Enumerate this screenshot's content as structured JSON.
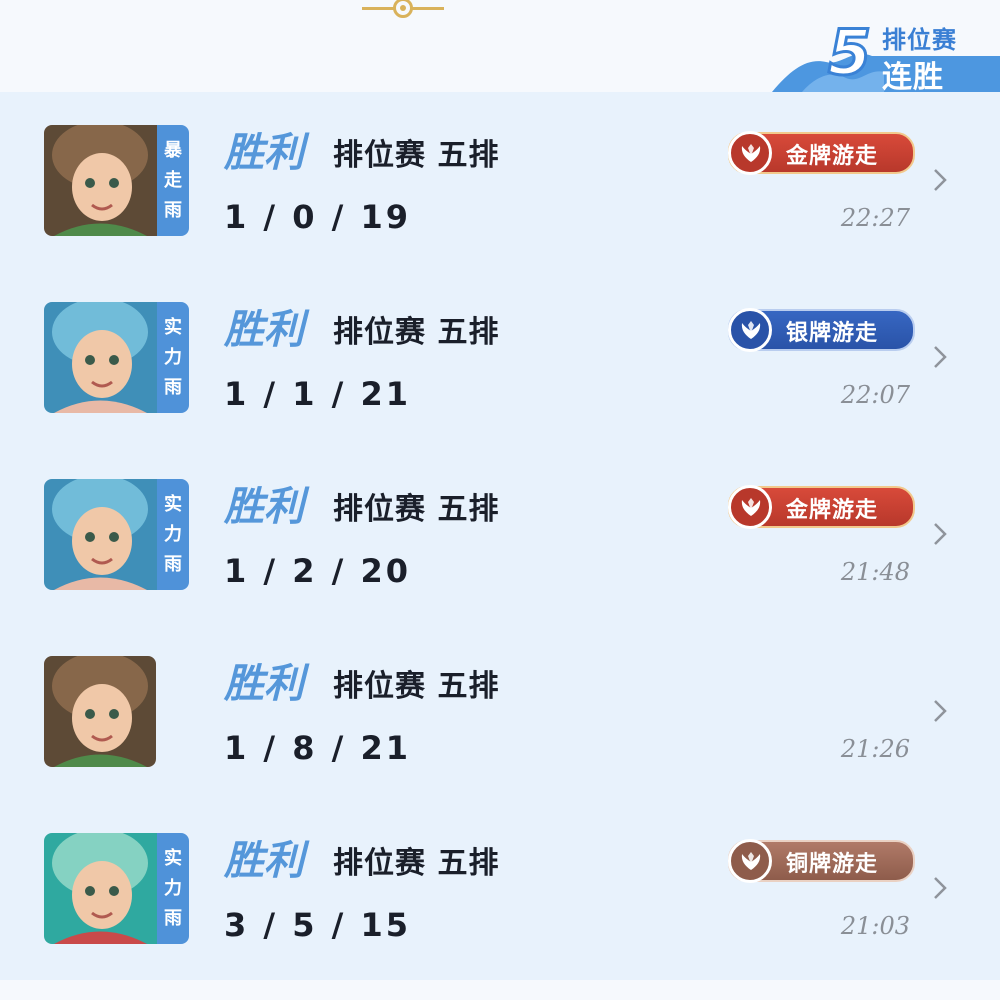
{
  "streak": {
    "number": "5",
    "line1": "排位赛",
    "line2": "连胜"
  },
  "matches": [
    {
      "result": "胜利",
      "mode": "排位赛 五排",
      "kda": "1 / 0 / 19",
      "time": "22:27",
      "badge": "金牌游走",
      "badge_tier": "gold",
      "hero_tag": [
        "暴",
        "走",
        "雨"
      ],
      "hero": "curly-hair-hero",
      "avatar_colors": [
        "#5d4a36",
        "#8c6a4c",
        "#4f8a4a"
      ]
    },
    {
      "result": "胜利",
      "mode": "排位赛 五排",
      "kda": "1 / 1 / 21",
      "time": "22:07",
      "badge": "银牌游走",
      "badge_tier": "silver",
      "hero_tag": [
        "实",
        "力",
        "雨"
      ],
      "hero": "mermaid-hero",
      "avatar_colors": [
        "#3f8fb8",
        "#77c1dd",
        "#e8b9a6"
      ]
    },
    {
      "result": "胜利",
      "mode": "排位赛 五排",
      "kda": "1 / 2 / 20",
      "time": "21:48",
      "badge": "金牌游走",
      "badge_tier": "gold",
      "hero_tag": [
        "实",
        "力",
        "雨"
      ],
      "hero": "mermaid-hero",
      "avatar_colors": [
        "#3f8fb8",
        "#77c1dd",
        "#e8b9a6"
      ]
    },
    {
      "result": "胜利",
      "mode": "排位赛 五排",
      "kda": "1 / 8 / 21",
      "time": "21:26",
      "badge": "",
      "badge_tier": "none",
      "hero_tag": [],
      "hero": "curly-hair-hero",
      "avatar_colors": [
        "#5d4a36",
        "#8c6a4c",
        "#4f8a4a"
      ]
    },
    {
      "result": "胜利",
      "mode": "排位赛 五排",
      "kda": "3 / 5 / 15",
      "time": "21:03",
      "badge": "铜牌游走",
      "badge_tier": "bronze",
      "hero_tag": [
        "实",
        "力",
        "雨"
      ],
      "hero": "green-hair-hero",
      "avatar_colors": [
        "#2fa9a0",
        "#8fd6c5",
        "#c94a4a"
      ]
    }
  ],
  "colors": {
    "result": "#5597da",
    "tag_bg": "#4f92d9",
    "gold": "#c43e31",
    "silver": "#2f5db6",
    "bronze": "#9a6756"
  }
}
